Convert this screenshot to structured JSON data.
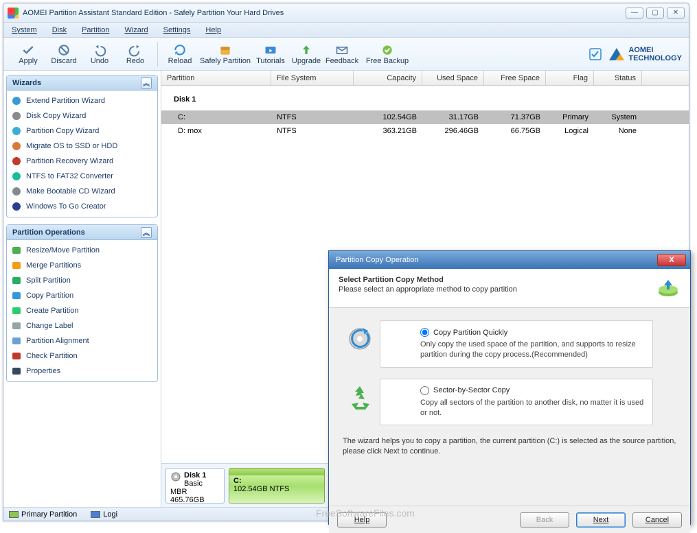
{
  "window": {
    "title": "AOMEI Partition Assistant Standard Edition - Safely Partition Your Hard Drives"
  },
  "menu": {
    "system": "System",
    "disk": "Disk",
    "partition": "Partition",
    "wizard": "Wizard",
    "settings": "Settings",
    "help": "Help"
  },
  "toolbar": {
    "apply": "Apply",
    "discard": "Discard",
    "undo": "Undo",
    "redo": "Redo",
    "reload": "Reload",
    "safely": "Safely Partition",
    "tutorials": "Tutorials",
    "upgrade": "Upgrade",
    "feedback": "Feedback",
    "freebackup": "Free Backup"
  },
  "brand": {
    "line1": "AOMEI",
    "line2": "TECHNOLOGY"
  },
  "sidebar": {
    "wizards_title": "Wizards",
    "wizards": [
      "Extend Partition Wizard",
      "Disk Copy Wizard",
      "Partition Copy Wizard",
      "Migrate OS to SSD or HDD",
      "Partition Recovery Wizard",
      "NTFS to FAT32 Converter",
      "Make Bootable CD Wizard",
      "Windows To Go Creator"
    ],
    "ops_title": "Partition Operations",
    "ops": [
      "Resize/Move Partition",
      "Merge Partitions",
      "Split Partition",
      "Copy Partition",
      "Create Partition",
      "Change Label",
      "Partition Alignment",
      "Check Partition",
      "Properties"
    ]
  },
  "grid": {
    "headers": {
      "partition": "Partition",
      "fs": "File System",
      "cap": "Capacity",
      "used": "Used Space",
      "free": "Free Space",
      "flag": "Flag",
      "status": "Status"
    },
    "disk_label": "Disk 1",
    "rows": [
      {
        "name": "C:",
        "fs": "NTFS",
        "cap": "102.54GB",
        "used": "31.17GB",
        "free": "71.37GB",
        "flag": "Primary",
        "status": "System"
      },
      {
        "name": "D: mox",
        "fs": "NTFS",
        "cap": "363.21GB",
        "used": "296.46GB",
        "free": "66.75GB",
        "flag": "Logical",
        "status": "None"
      }
    ]
  },
  "diskmap": {
    "disk_name": "Disk 1",
    "disk_type": "Basic MBR",
    "disk_size": "465.76GB",
    "part_name": "C:",
    "part_desc": "102.54GB NTFS"
  },
  "statusbar": {
    "primary": "Primary Partition",
    "logical": "Logi"
  },
  "dialog": {
    "title": "Partition Copy Operation",
    "head_title": "Select Partition Copy Method",
    "head_sub": "Please select an appropriate method to copy partition",
    "opt1_label": "Copy Partition Quickly",
    "opt1_desc": "Only copy the used space of the partition, and supports to resize partition during the copy process.(Recommended)",
    "opt2_label": "Sector-by-Sector Copy",
    "opt2_desc": "Copy all sectors of the partition to another disk, no matter it is used or not.",
    "footnote": "The wizard helps you to copy a partition, the current partition (C:) is selected as the source partition, please click Next to continue.",
    "btn_help": "Help",
    "btn_back": "Back",
    "btn_next": "Next",
    "btn_cancel": "Cancel"
  },
  "watermark": "FreeSoftwareFiles.com"
}
